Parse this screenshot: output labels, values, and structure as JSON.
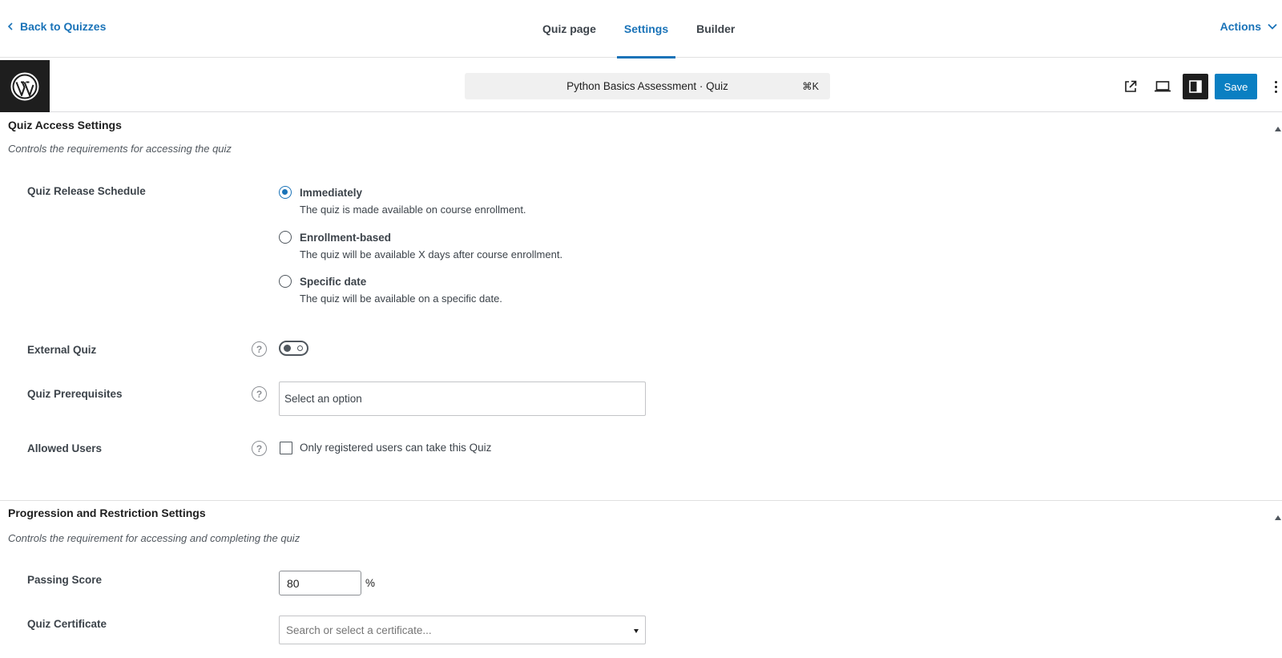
{
  "topnav": {
    "back_label": "Back to Quizzes",
    "tabs": [
      {
        "label": "Quiz page"
      },
      {
        "label": "Settings"
      },
      {
        "label": "Builder"
      }
    ],
    "active_tab": "Settings",
    "actions_label": "Actions"
  },
  "editor_header": {
    "logo_icon": "wordpress-logo-icon",
    "command_bar_title": "Python Basics Assessment · Quiz",
    "command_bar_shortcut": "⌘K",
    "save_label": "Save",
    "icons": [
      "external-link-icon",
      "desktop-preview-icon",
      "sidebar-toggle-icon",
      "more-options-icon"
    ]
  },
  "access_section": {
    "title": "Quiz Access Settings",
    "description": "Controls the requirements for accessing the quiz",
    "release_schedule": {
      "label": "Quiz Release Schedule",
      "options": [
        {
          "label": "Immediately",
          "description": "The quiz is made available on course enrollment.",
          "checked": true
        },
        {
          "label": "Enrollment-based",
          "description": "The quiz will be available X days after course enrollment.",
          "checked": false
        },
        {
          "label": "Specific date",
          "description": "The quiz will be available on a specific date.",
          "checked": false
        }
      ]
    },
    "external_quiz": {
      "label": "External Quiz",
      "enabled": false
    },
    "prerequisites": {
      "label": "Quiz Prerequisites",
      "placeholder": "Select an option"
    },
    "allowed_users": {
      "label": "Allowed Users",
      "checkbox_label": "Only registered users can take this Quiz",
      "checked": false
    }
  },
  "progression_section": {
    "title": "Progression and Restriction Settings",
    "description": "Controls the requirement for accessing and completing the quiz",
    "passing_score": {
      "label": "Passing Score",
      "value": "80",
      "unit": "%"
    },
    "certificate": {
      "label": "Quiz Certificate",
      "placeholder": "Search or select a certificate..."
    }
  },
  "colors": {
    "accent": "#1a73b8",
    "save_button": "#0a7fc2",
    "dark": "#1e1e1e"
  }
}
